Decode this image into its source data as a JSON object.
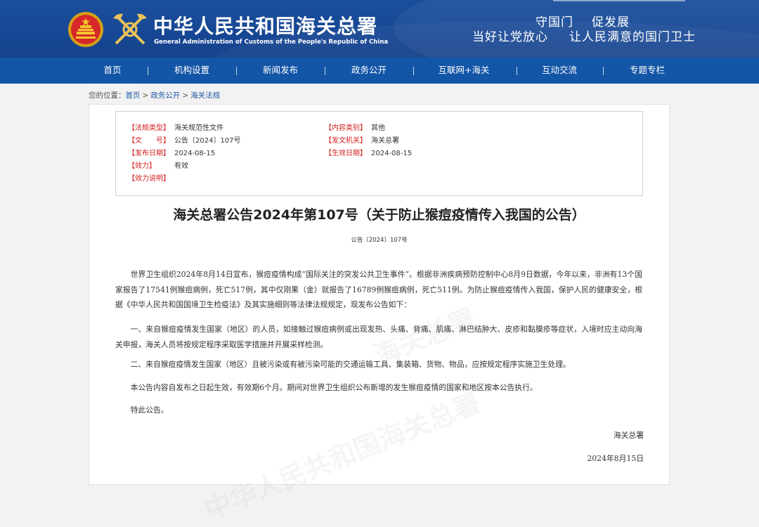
{
  "header": {
    "site_title": "中华人民共和国海关总署",
    "site_subtitle": "General Administration of Customs of the People's Republic of China",
    "slogan_line1": [
      "守国门",
      "促发展"
    ],
    "slogan_line2": [
      "当好让党放心",
      "让人民满意的国门卫士"
    ]
  },
  "nav": {
    "items": [
      "首页",
      "机构设置",
      "新闻发布",
      "政务公开",
      "互联网+海关",
      "互动交流",
      "专题专栏"
    ],
    "active_index": 0
  },
  "breadcrumb": {
    "prefix": "您的位置：",
    "items": [
      "首页",
      "政务公开",
      "海关法规"
    ],
    "separator": ">"
  },
  "meta": {
    "left": [
      {
        "key": "【法规类型】",
        "value": "海关规范性文件"
      },
      {
        "key": "【文　　号】",
        "value": "公告〔2024〕107号"
      },
      {
        "key": "【发布日期】",
        "value": "2024-08-15"
      },
      {
        "key": "【效力】",
        "value": "有效"
      },
      {
        "key": "【效力说明】",
        "value": ""
      }
    ],
    "right": [
      {
        "key": "【内容类别】",
        "value": "其他"
      },
      {
        "key": "【发文机关】",
        "value": "海关总署"
      },
      {
        "key": "【生效日期】",
        "value": "2024-08-15"
      }
    ]
  },
  "document": {
    "title": "海关总署公告2024年第107号（关于防止猴痘疫情传入我国的公告）",
    "number": "公告〔2024〕107号",
    "paragraphs": [
      "世界卫生组织2024年8月14日宣布，猴痘疫情构成“国际关注的突发公共卫生事件”。根据非洲疾病预防控制中心8月9日数据，今年以来，非洲有13个国家报告了17541例猴痘病例，死亡517例，其中仅刚果（金）就报告了16789例猴痘病例，死亡511例。为防止猴痘疫情传入我国，保护人民的健康安全，根据《中华人民共和国国境卫生检疫法》及其实施细则等法律法规规定，现发布公告如下：",
      "一、来自猴痘疫情发生国家（地区）的人员，如接触过猴痘病例或出现发热、头痛、背痛、肌痛、淋巴结肿大、皮疹和黏膜疹等症状，入境时应主动向海关申报，海关人员将按规定程序采取医学措施并开展采样检测。",
      "二、来自猴痘疫情发生国家（地区）且被污染或有被污染可能的交通运输工具、集装箱、货物、物品，应按规定程序实施卫生处理。",
      "本公告内容自发布之日起生效，有效期6个月。期间对世界卫生组织公布新增的发生猴痘疫情的国家和地区按本公告执行。",
      "特此公告。"
    ],
    "signature": "海关总署",
    "date": "2024年8月15日"
  },
  "colors": {
    "banner": "#174794",
    "navbar": "#1355a6",
    "meta_key": "#d41f1f",
    "link": "#1c56a8"
  }
}
